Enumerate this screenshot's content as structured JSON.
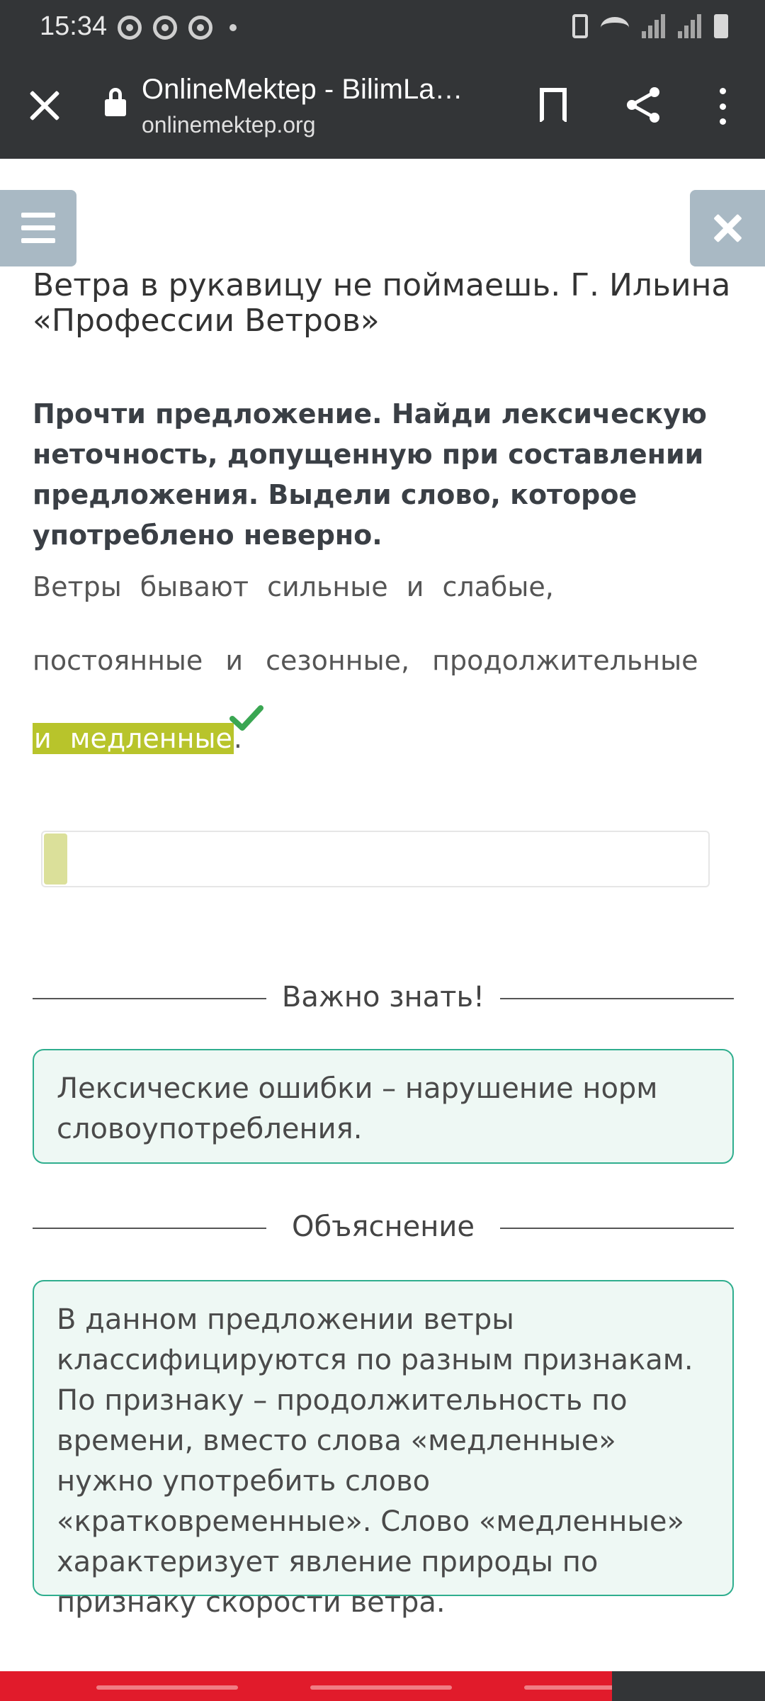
{
  "status_bar": {
    "time": "15:34"
  },
  "browser": {
    "title": "OnlineMektep - BilimLa…",
    "url": "onlinemektep.org"
  },
  "lesson": {
    "title": "Ветра в рукавицу не поймаешь. Г. Ильина «Профессии Ветров»",
    "instruction": "Прочти предложение. Найди лексическую неточность, допущенную при составлении предложения. Выдели слово, которое употреблено неверно.",
    "sentence": {
      "line1": "Ветры бывают сильные и слабые,",
      "line2": "постоянные и сезонные, продолжительные",
      "highlighted": "и медленные",
      "end": "."
    },
    "progress_percent": 3.5
  },
  "important": {
    "heading": "Важно знать!",
    "text": "Лексические ошибки – нарушение норм словоупотребления."
  },
  "explanation": {
    "heading": "Объяснение",
    "text": "В данном предложении ветры классифицируются по разным признакам. По признаку – продолжительность по времени, вместо слова «медленные» нужно употребить слово «кратковременные». Слово «медленные» характеризует явление природы по признаку скорости ветра."
  },
  "colors": {
    "dark_bar": "#333537",
    "side_button": "#a9b9c4",
    "highlight": "#b8c42b",
    "check": "#3aa652",
    "info_border": "#2fae8e",
    "info_bg": "#eef8f4",
    "nav_bar": "#e11b2b"
  }
}
